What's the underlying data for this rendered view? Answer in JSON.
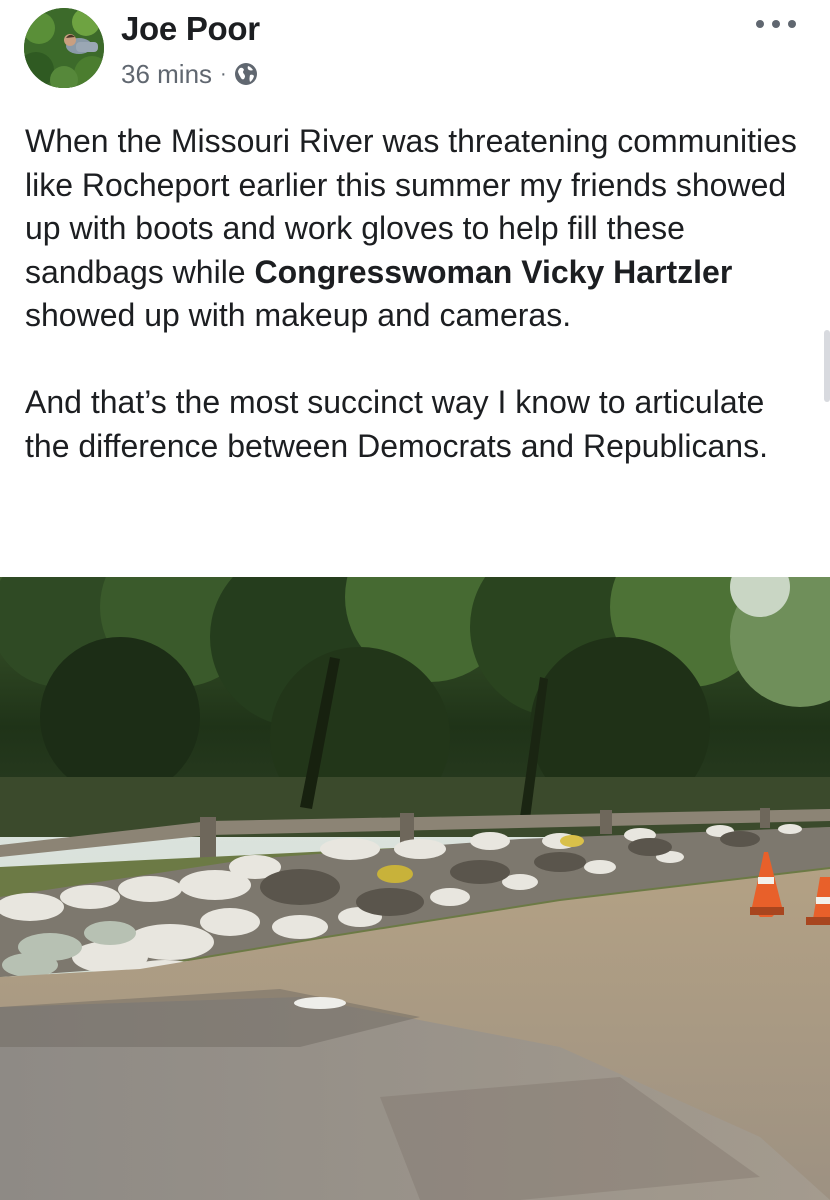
{
  "post": {
    "author": "Joe Poor",
    "time": "36 mins",
    "separator": "·",
    "privacy_icon": "globe-icon",
    "more_icon": "more-horizontal-icon",
    "text": {
      "p1_part1": "When the Missouri River was threatening communities like Rocheport earlier this summer my friends showed up with boots and work gloves to help fill these sandbags while ",
      "p1_bold": "Congresswoman Vicky Hartzler",
      "p1_part2": " showed up with makeup and cameras.",
      "p2": "And that’s the most succinct way I know to articulate the difference between Democrats and Republicans."
    },
    "photo_icon": "sandbag-wall-photo"
  },
  "colors": {
    "text": "#1c1e21",
    "secondary": "#606770",
    "background": "#ffffff"
  }
}
